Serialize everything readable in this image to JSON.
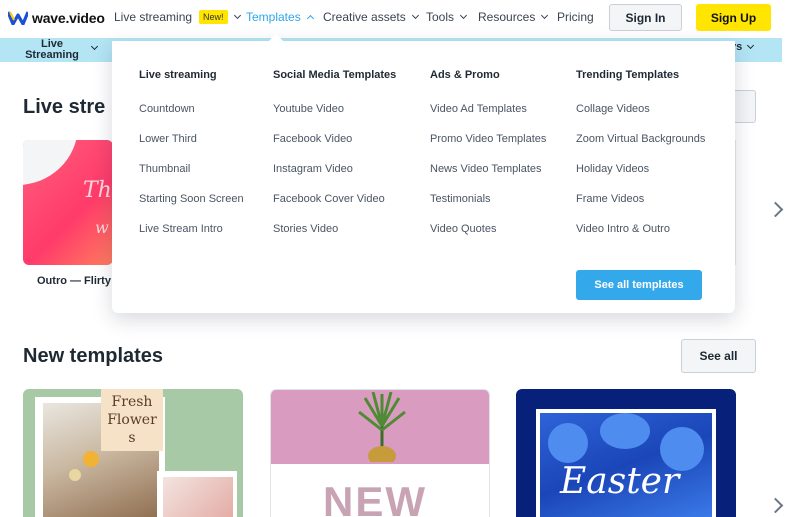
{
  "brand": {
    "name": "wave.video",
    "accent": "#2fa7e8",
    "yellow": "#ffe500"
  },
  "nav": {
    "items": [
      {
        "label": "Live streaming",
        "badge": "New!"
      },
      {
        "label": "Templates"
      },
      {
        "label": "Creative assets"
      },
      {
        "label": "Tools"
      },
      {
        "label": "Resources"
      },
      {
        "label": "Pricing"
      }
    ],
    "signin": "Sign In",
    "signup": "Sign Up"
  },
  "catbar": {
    "left_label_1": "Live",
    "left_label_2": "Streaming",
    "right_label": "ys"
  },
  "dropdown": {
    "columns": [
      {
        "title": "Live streaming",
        "links": [
          "Countdown",
          "Lower Third",
          "Thumbnail",
          "Starting Soon Screen",
          "Live Stream Intro"
        ]
      },
      {
        "title": "Social Media Templates",
        "links": [
          "Youtube Video",
          "Facebook Video",
          "Instagram Video",
          "Facebook Cover Video",
          "Stories Video"
        ]
      },
      {
        "title": "Ads & Promo",
        "links": [
          "Video Ad Templates",
          "Promo Video Templates",
          "News Video Templates",
          "Testimonials",
          "Video Quotes"
        ]
      },
      {
        "title": "Trending Templates",
        "links": [
          "Collage Videos",
          "Zoom Virtual Backgrounds",
          "Holiday Videos",
          "Frame Videos",
          "Video Intro & Outro"
        ]
      }
    ],
    "see_all": "See all templates"
  },
  "sections": {
    "live": {
      "title": "Live stre",
      "card_caption": "Outro — Flirty",
      "card_text_1": "Th",
      "card_text_2": "w"
    },
    "new_templates": {
      "title": "New templates",
      "see_all": "See all",
      "cards": [
        {
          "tag_lines": [
            "Fresh",
            "Flower",
            "s"
          ]
        },
        {
          "text": "NEW"
        },
        {
          "text": "Easter"
        }
      ]
    }
  }
}
